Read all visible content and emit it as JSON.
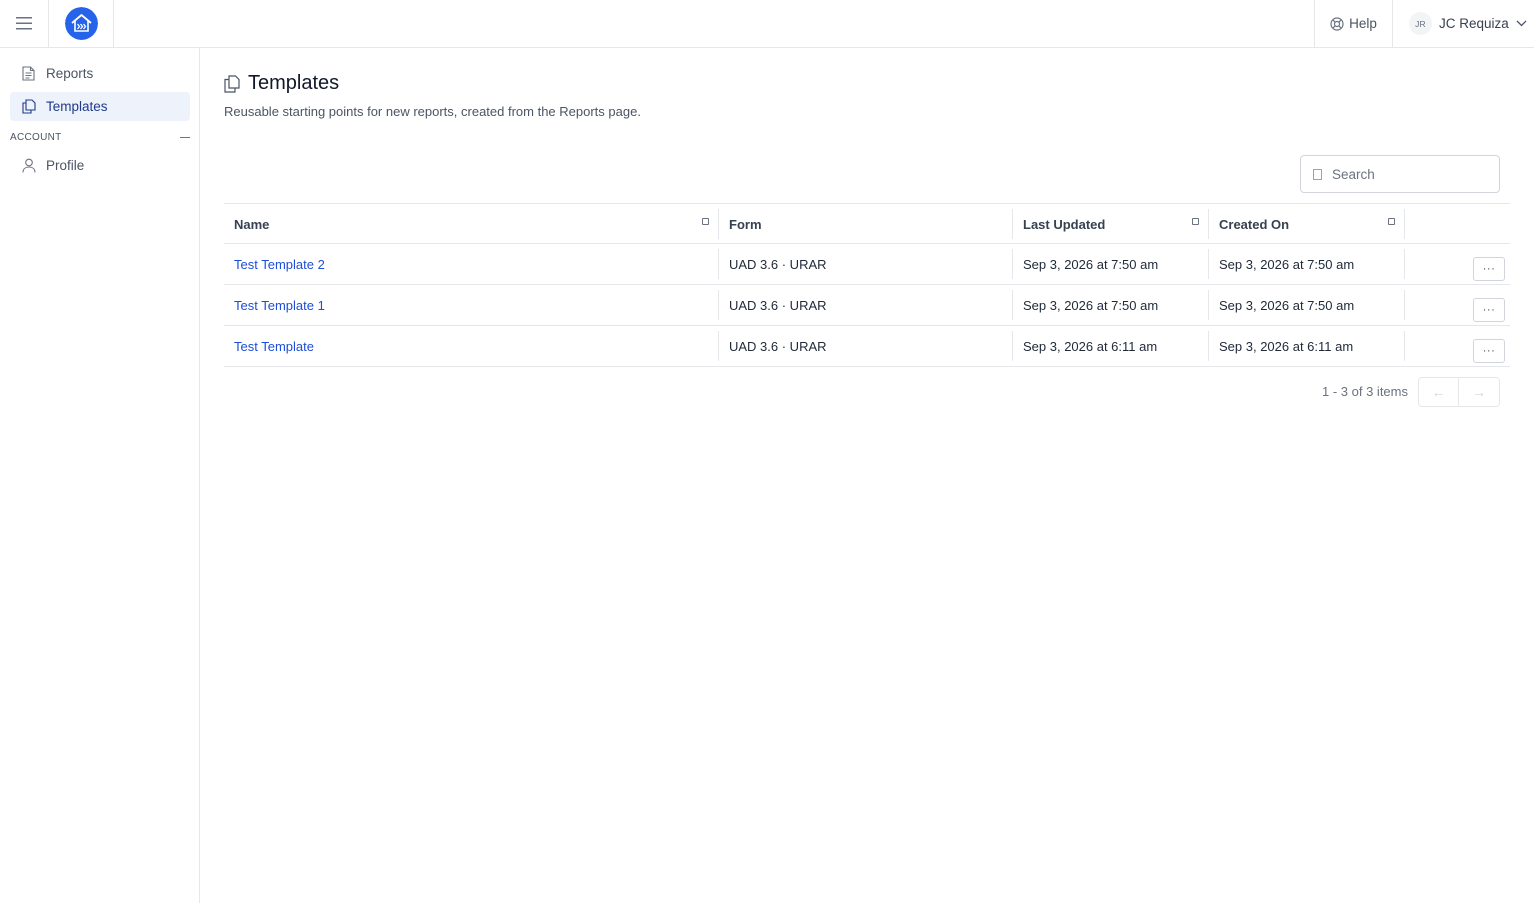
{
  "header": {
    "help_label": "Help",
    "user_initials": "JR",
    "user_name": "JC Requiza"
  },
  "sidebar": {
    "items": [
      {
        "label": "Reports",
        "icon": "document-icon"
      },
      {
        "label": "Templates",
        "icon": "copy-icon",
        "active": true
      }
    ],
    "section_title": "ACCOUNT",
    "account_items": [
      {
        "label": "Profile",
        "icon": "user-icon"
      }
    ]
  },
  "page": {
    "title": "Templates",
    "subtitle": "Reusable starting points for new reports, created from the Reports page."
  },
  "search": {
    "placeholder": "Search"
  },
  "table": {
    "columns": [
      "Name",
      "Form",
      "Last Updated",
      "Created On"
    ],
    "rows": [
      {
        "name": "Test Template 2",
        "form": "UAD 3.6 · URAR",
        "updated": "Sep 3, 2026 at 7:50 am",
        "created": "Sep 3, 2026 at 7:50 am",
        "action": "···"
      },
      {
        "name": "Test Template 1",
        "form": "UAD 3.6 · URAR",
        "updated": "Sep 3, 2026 at 7:50 am",
        "created": "Sep 3, 2026 at 7:50 am",
        "action": "···"
      },
      {
        "name": "Test Template",
        "form": "UAD 3.6 · URAR",
        "updated": "Sep 3, 2026 at 6:11 am",
        "created": "Sep 3, 2026 at 6:11 am",
        "action": "···"
      }
    ]
  },
  "pagination": {
    "info": "1 - 3 of 3 items",
    "prev": "←",
    "next": "→"
  },
  "colors": {
    "brand": "#2563eb",
    "link": "#1d4ed8",
    "active_bg": "#eef2fb"
  }
}
